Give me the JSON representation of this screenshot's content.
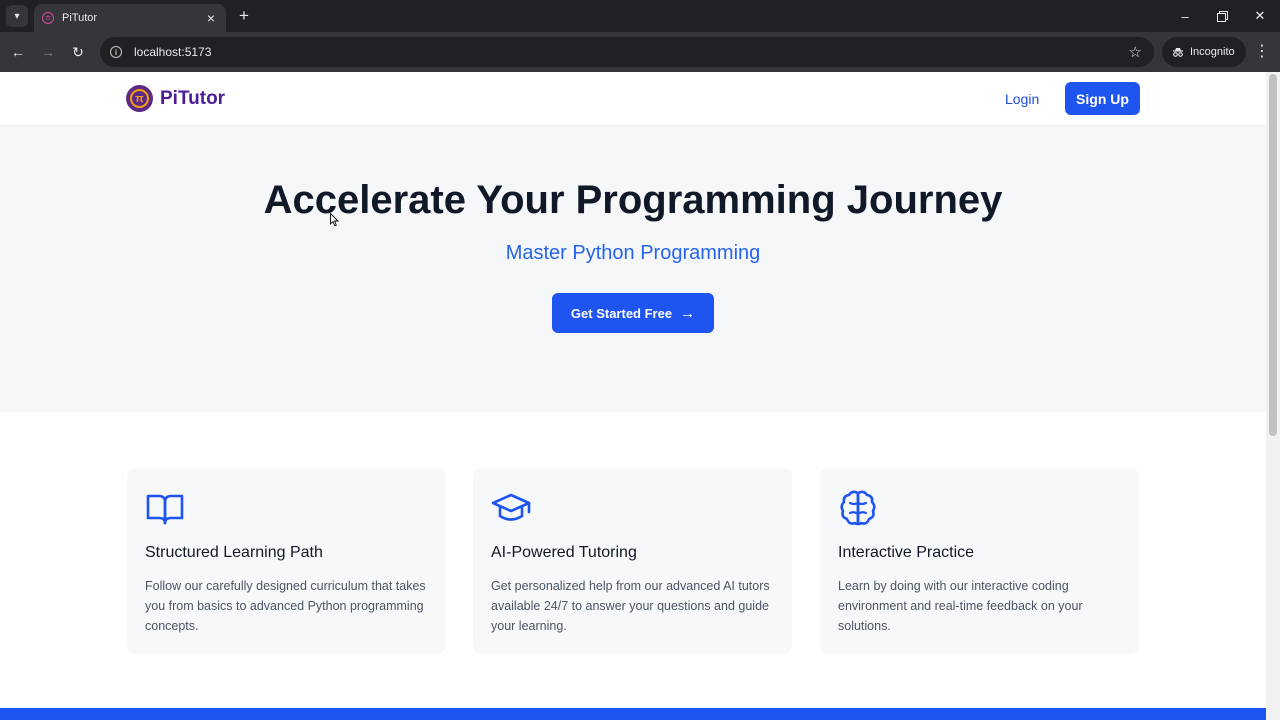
{
  "browser": {
    "tab_title": "PiTutor",
    "url": "localhost:5173",
    "profile_label": "Incognito"
  },
  "header": {
    "brand": "PiTutor",
    "login": "Login",
    "signup": "Sign Up"
  },
  "hero": {
    "title": "Accelerate Your Programming Journey",
    "subtitle": "Master Python Programming",
    "cta": "Get Started Free"
  },
  "features": [
    {
      "icon": "book-open-icon",
      "title": "Structured Learning Path",
      "description": "Follow our carefully designed curriculum that takes you from basics to advanced Python programming concepts."
    },
    {
      "icon": "graduation-cap-icon",
      "title": "AI-Powered Tutoring",
      "description": "Get personalized help from our advanced AI tutors available 24/7 to answer your questions and guide your learning."
    },
    {
      "icon": "brain-icon",
      "title": "Interactive Practice",
      "description": "Learn by doing with our interactive coding environment and real-time feedback on your solutions."
    }
  ],
  "colors": {
    "primary": "#1e55f0",
    "brand": "#4c1d95",
    "accent_text": "#2563eb"
  }
}
